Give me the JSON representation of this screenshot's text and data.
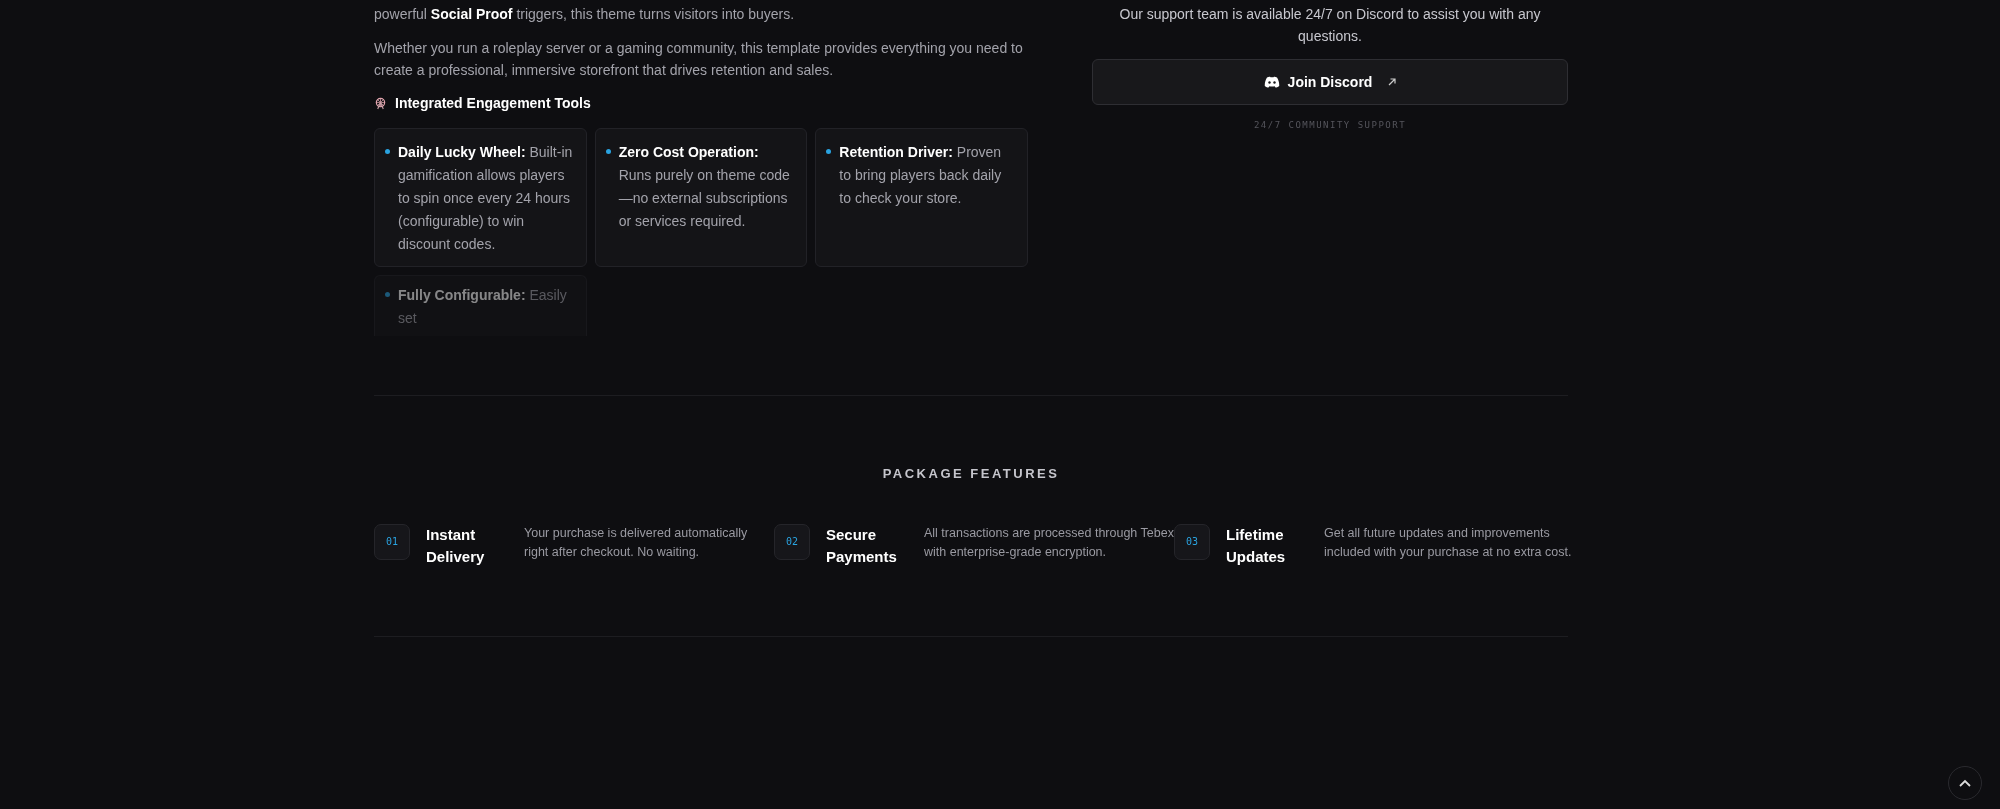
{
  "intro": {
    "paragraphs": [
      "powerful **Social Proof** triggers, this theme turns visitors into buyers.",
      "Whether you run a roleplay server or a gaming community, this template provides everything you need to create a professional, immersive storefront that drives retention and sales."
    ]
  },
  "tools": {
    "heading": "Integrated Engagement Tools",
    "items": [
      {
        "title": "Daily Lucky Wheel:",
        "text": "Built-in gamification allows players to spin once every 24 hours (configurable) to win discount codes.",
        "faded": false
      },
      {
        "title": "Zero Cost Operation:",
        "text": "Runs purely on theme code—no external subscriptions or services required.",
        "faded": false
      },
      {
        "title": "Retention Driver:",
        "text": "Proven to bring players back daily to check your store.",
        "faded": false
      },
      {
        "title": "Fully Configurable:",
        "text": "Easily set",
        "faded": true
      }
    ]
  },
  "support": {
    "text": "Our support team is available 24/7 on Discord to assist you with any questions.",
    "button": "Join Discord",
    "caption": "24/7 COMMUNITY SUPPORT"
  },
  "package_features": {
    "heading": "PACKAGE FEATURES",
    "items": [
      {
        "number": "01",
        "title": "Instant Delivery",
        "text": "Your purchase is delivered automatically right after checkout. No waiting."
      },
      {
        "number": "02",
        "title": "Secure Payments",
        "text": "All transactions are processed through Tebex with enterprise-grade encryption."
      },
      {
        "number": "03",
        "title": "Lifetime Updates",
        "text": "Get all future updates and improvements included with your purchase at no extra cost."
      }
    ]
  }
}
